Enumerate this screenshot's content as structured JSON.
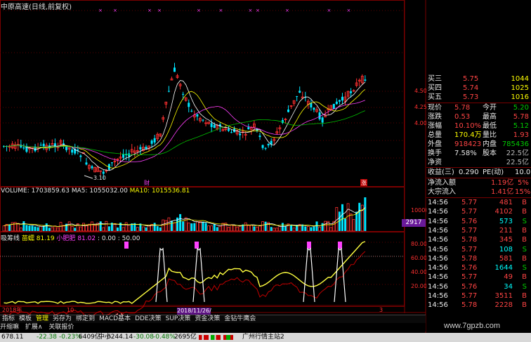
{
  "window": {
    "title": "中原高速(日线,前复权)"
  },
  "price_chart": {
    "y_ticks": [
      "4.50",
      "4.25",
      "4.00"
    ],
    "low_label": "3.10",
    "marker_cai": "财",
    "marker_zhang": "涨"
  },
  "volume_panel": {
    "label_volume": "VOLUME: 1703859.63",
    "label_ma5": "MA5: 1055032.00",
    "label_ma10": "MA10: 1015536.81",
    "y_tick": "10000",
    "badge": "2917"
  },
  "indicator_panel": {
    "name": "吸筹线",
    "label1_name": "苗蠕",
    "label1_val": "81.19",
    "label2_name": "小肥肥",
    "label2_val": "81.02",
    "label3": ": 0.00",
    "label4": ": 50.00",
    "y_ticks": [
      "80.00",
      "60.00",
      "40.00",
      "20.00"
    ]
  },
  "x_axis": {
    "year_label": "2018年",
    "tick_10": "10",
    "tick_3": "3",
    "date_badge": "2018/11/26/一"
  },
  "toolbar": {
    "items": [
      "指标",
      "模板",
      "管理",
      "另存为",
      "绑定到",
      "MACD基本",
      "DDE决策",
      "SUP决策",
      "资金决策",
      "金钻牛鹰会"
    ]
  },
  "menu2": {
    "items": [
      "开缩嘛",
      "扩展∧",
      "关联报价"
    ]
  },
  "order_book": {
    "rows": [
      {
        "label": "买三",
        "price": "5.75",
        "vol": "1044"
      },
      {
        "label": "买四",
        "price": "5.74",
        "vol": "1025"
      },
      {
        "label": "买五",
        "price": "5.73",
        "vol": "1016"
      }
    ]
  },
  "quote": {
    "rows": [
      {
        "l1": "现价",
        "v1": "5.78",
        "l2": "今开",
        "v2": "5.20"
      },
      {
        "l1": "涨跌",
        "v1": "0.53",
        "l2": "最高",
        "v2": "5.78"
      },
      {
        "l1": "涨幅",
        "v1": "10.10%",
        "l2": "最低",
        "v2": "5.12"
      },
      {
        "l1": "总量",
        "v1": "170.4万",
        "l2": "量比",
        "v2": "1.93"
      },
      {
        "l1": "外盘",
        "v1": "918423",
        "l2": "内盘",
        "v2": "785436"
      },
      {
        "l1": "换手",
        "v1": "7.58%",
        "l2": "股本",
        "v2": "22.5亿"
      },
      {
        "l1": "净资",
        "v1": "",
        "l2": "",
        "v2": "22.5亿"
      }
    ],
    "profit_label": "收益(三)",
    "profit_val": "0.290",
    "pe_label": "PE(动)",
    "pe_val": "10.0",
    "net_inflow_label": "净流入额",
    "net_inflow_val": "1.19亿",
    "net_inflow_pct": "5%",
    "bulk_label": "大宗流入",
    "bulk_val": "1.41亿",
    "bulk_pct": "15%"
  },
  "ticks": {
    "rows": [
      {
        "time": "14:56",
        "price": "5.77",
        "vol": "481",
        "side": "B"
      },
      {
        "time": "14:56",
        "price": "5.77",
        "vol": "4102",
        "side": "B"
      },
      {
        "time": "14:56",
        "price": "5.76",
        "vol": "573",
        "side": "S"
      },
      {
        "time": "14:56",
        "price": "5.77",
        "vol": "211",
        "side": "B"
      },
      {
        "time": "14:56",
        "price": "5.78",
        "vol": "345",
        "side": "B"
      },
      {
        "time": "14:56",
        "price": "5.77",
        "vol": "108",
        "side": "S"
      },
      {
        "time": "14:56",
        "price": "5.78",
        "vol": "581",
        "side": "B"
      },
      {
        "time": "14:56",
        "price": "5.76",
        "vol": "1644",
        "side": "S"
      },
      {
        "time": "14:56",
        "price": "5.77",
        "vol": "49",
        "side": "B"
      },
      {
        "time": "14:56",
        "price": "5.76",
        "vol": "34",
        "side": "S"
      },
      {
        "time": "14:56",
        "price": "5.77",
        "vol": "3511",
        "side": "B"
      },
      {
        "time": "14:56",
        "price": "5.78",
        "vol": "2228",
        "side": "B"
      }
    ]
  },
  "statusbar": {
    "idx1_val": "678.11",
    "idx1_chg": "-22.38",
    "idx1_pct": "-0.23%",
    "idx1_amt": "6409亿",
    "idx2_name": "中小",
    "idx2_val": "6244.14",
    "idx2_chg": "-30.08",
    "idx2_pct": "-0.48%",
    "idx2_amt": "2695亿",
    "site": "广州行情主站2"
  },
  "watermark": "www.7gpzb.com",
  "colors": {
    "up": "#ff3030",
    "down": "#00e5ff",
    "grid": "#7a0000",
    "ma_white": "#ffffff",
    "ma_yellow": "#ffff00",
    "ma_magenta": "#ff40ff",
    "ma_green": "#00c000"
  }
}
